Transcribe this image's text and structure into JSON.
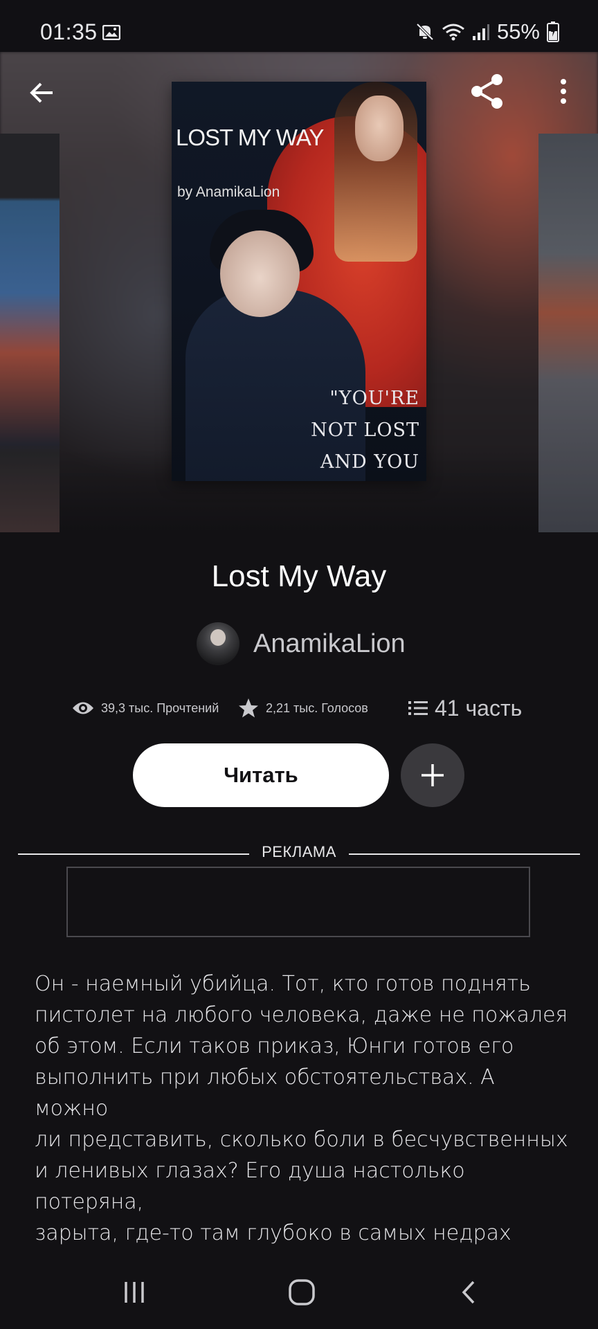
{
  "status_bar": {
    "time": "01:35",
    "battery": "55%",
    "icons": [
      "image-icon",
      "mute-icon",
      "wifi-icon",
      "signal-icon",
      "battery-icon"
    ]
  },
  "header": {
    "icons": [
      "back-arrow-icon",
      "share-icon",
      "more-vert-icon"
    ]
  },
  "cover": {
    "title_text": "LOST MY WAY",
    "byline": "by AnamikaLion",
    "quote": "\"YOU'RE NOT LOST\nAND YOU DON'T\nNEED TO SEEK\""
  },
  "story": {
    "title": "Lost My Way",
    "author": "AnamikaLion"
  },
  "stats": {
    "reads": "39,3 тыс. Прочтений",
    "votes": "2,21 тыс. Голосов",
    "parts": "41 часть"
  },
  "actions": {
    "read_label": "Читать",
    "add_icon": "plus-icon"
  },
  "ad": {
    "label": "РЕКЛАМА"
  },
  "description": "Он - наемный убийца. Тот, кто готов поднять\nпистолет на любого человека, даже не пожалея\nоб этом. Если таков приказ, Юнги готов его\nвыполнить при любых обстоятельствах. А можно\nли представить, сколько боли в бесчувственных\nи ленивых глазах? Его душа настолько потеряна,\nзарыта, где-то там глубоко в самых недрах\nземли...\nМожно ли это изменить?",
  "nav_bar": {
    "icons": [
      "recents-icon",
      "home-icon",
      "nav-back-icon"
    ]
  },
  "colors": {
    "background": "#121114",
    "button_bg": "#ffffff",
    "add_button_bg": "#3a393d",
    "text_secondary": "#c9c9cd"
  }
}
